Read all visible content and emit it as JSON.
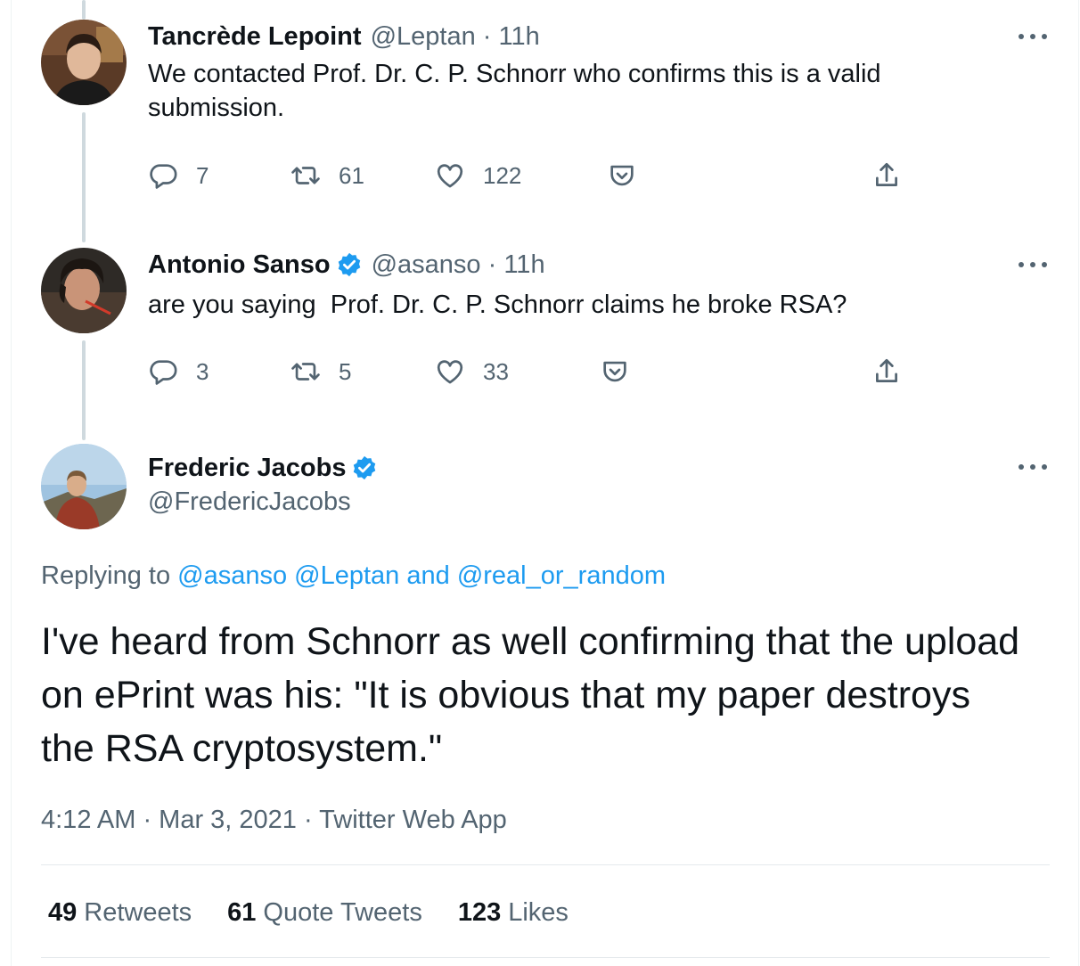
{
  "tweets": [
    {
      "name": "Tancrède Lepoint",
      "handle": "@Leptan",
      "time": "11h",
      "handle_time": "@Leptan · 11h",
      "verified": false,
      "text": "We contacted Prof. Dr. C. P. Schnorr who confirms this is a valid submission.",
      "replies": "7",
      "retweets": "61",
      "likes": "122"
    },
    {
      "name": "Antonio Sanso",
      "handle": "@asanso",
      "time": "11h",
      "handle_time": "@asanso · 11h",
      "verified": true,
      "text": "are you saying  Prof. Dr. C. P. Schnorr claims he broke RSA?",
      "replies": "3",
      "retweets": "5",
      "likes": "33"
    }
  ],
  "main_tweet": {
    "name": "Frederic Jacobs",
    "handle": "@FredericJacobs",
    "verified": true,
    "replying_prefix": "Replying to",
    "replying_mentions": [
      "@asanso",
      "@Leptan",
      "@real_or_random"
    ],
    "replying_and": "and",
    "text": "I've heard from Schnorr as well confirming that the upload on ePrint was his: \"It is obvious that my paper destroys the RSA cryptosystem.\"",
    "timestamp": "4:12 AM · Mar 3, 2021 · Twitter Web App",
    "stats": {
      "retweets_count": "49",
      "retweets_label": "Retweets",
      "quotes_count": "61",
      "quotes_label": "Quote Tweets",
      "likes_count": "123",
      "likes_label": "Likes"
    }
  },
  "icons": {
    "reply": "reply-icon",
    "retweet": "retweet-icon",
    "like": "heart-icon",
    "pocket": "pocket-icon",
    "share": "share-icon",
    "more": "more-icon",
    "verified": "verified-badge-icon"
  },
  "colors": {
    "link": "#1d9bf0",
    "secondary_text": "#536471",
    "primary_text": "#0f1419",
    "thread_line": "#cfd9de"
  }
}
